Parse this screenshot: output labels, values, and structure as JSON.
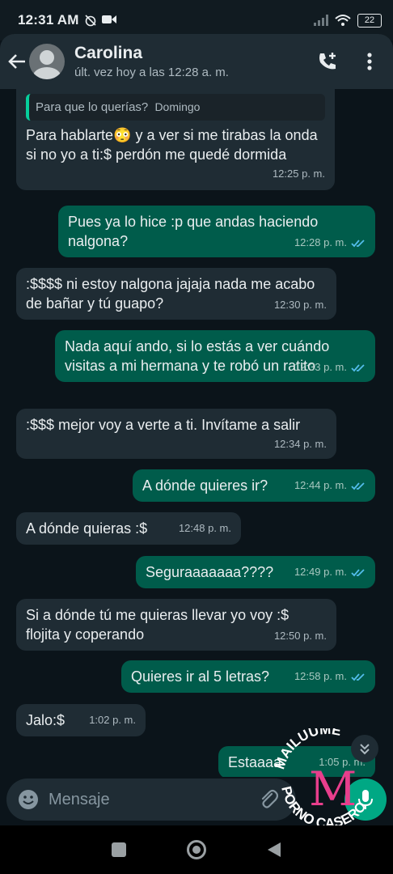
{
  "status_bar": {
    "time": "12:31 AM",
    "battery": "22"
  },
  "header": {
    "contact_name": "Carolina",
    "last_seen": "últ. vez hoy a las 12:28 a. m."
  },
  "messages": [
    {
      "quote": "Para que lo querías?",
      "quote_day": "Domingo",
      "text": "Para hablarte😳 y a ver si me tirabas la onda si no yo a ti:$ perdón me quedé dormida",
      "time": "12:25 p. m."
    },
    {
      "text": "Pues ya lo hice :p que andas haciendo nalgona?",
      "time": "12:28 p. m."
    },
    {
      "text": ":$$$$ ni estoy nalgona jajaja nada me acabo de bañar y tú guapo?",
      "time": "12:30 p. m."
    },
    {
      "text": "Nada aquí ando, si lo estás a ver cuándo visitas a mi hermana y te robó un ratito",
      "time": "12:33 p. m."
    },
    {
      "text": ":$$$ mejor voy a verte a ti. Invítame a salir",
      "time": "12:34 p. m."
    },
    {
      "text": "A dónde quieres ir?",
      "time": "12:44 p. m."
    },
    {
      "text": "A dónde quieras :$",
      "time": "12:48 p. m."
    },
    {
      "text": "Seguraaaaaaa????",
      "time": "12:49 p. m."
    },
    {
      "text": "Si a dónde tú me quieras llevar yo voy :$ flojita y coperando",
      "time": "12:50 p. m."
    },
    {
      "text": "Quieres ir al 5 letras?",
      "time": "12:58 p. m."
    },
    {
      "text": "Jalo:$",
      "time": "1:02 p. m."
    },
    {
      "text": "Estaaaa",
      "time": "1:05 p. m."
    }
  ],
  "input": {
    "placeholder": "Mensaje"
  },
  "watermark": {
    "top": "MAILUUME",
    "letter": "M",
    "bottom": "PORNO CASERO"
  },
  "colors": {
    "incoming_bubble": "#1f2c34",
    "outgoing_bubble": "#005c4b",
    "read_ticks": "#53bdeb",
    "accent": "#00a884"
  },
  "icons": [
    "back-arrow-icon",
    "add-call-icon",
    "more-options-icon",
    "emoji-icon",
    "attach-icon",
    "mic-icon",
    "scroll-down-icon"
  ]
}
